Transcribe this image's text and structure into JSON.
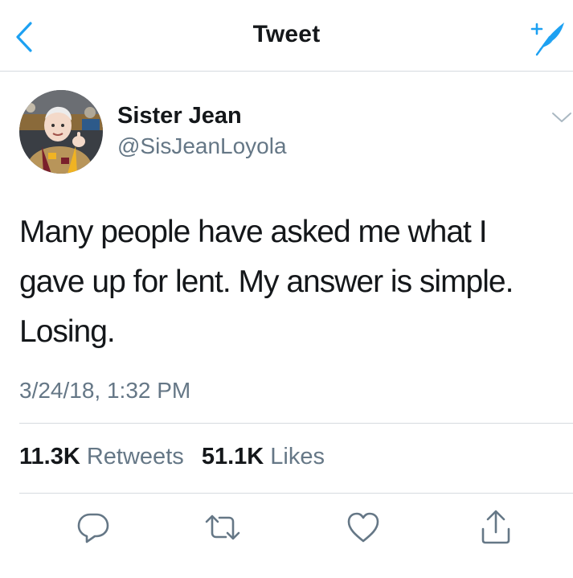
{
  "nav": {
    "title": "Tweet",
    "back_icon": "chevron-left-icon",
    "compose_icon": "compose-feather-icon"
  },
  "tweet": {
    "author": {
      "display_name": "Sister Jean",
      "handle": "@SisJeanLoyola"
    },
    "text": "Many people have asked me what I\ngave up for lent. My answer is simple.\nLosing.",
    "timestamp": "3/24/18, 1:32 PM",
    "stats": {
      "retweets_count": "11.3K",
      "retweets_label": "Retweets",
      "likes_count": "51.1K",
      "likes_label": "Likes"
    }
  },
  "actions": [
    "reply-icon",
    "retweet-icon",
    "like-icon",
    "share-icon"
  ],
  "colors": {
    "accent": "#1da1f2",
    "text_primary": "#14171a",
    "text_secondary": "#657786",
    "divider": "#d6dbe0"
  }
}
